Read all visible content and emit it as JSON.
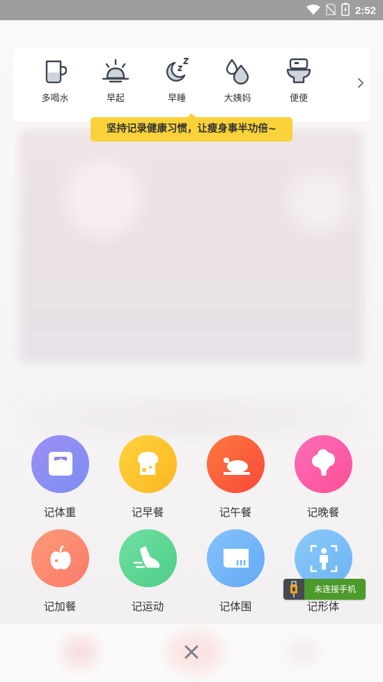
{
  "status_bar": {
    "time": "2:52"
  },
  "habits": [
    {
      "label": "多喝水",
      "icon": "cup-icon"
    },
    {
      "label": "早起",
      "icon": "sunrise-icon"
    },
    {
      "label": "早睡",
      "icon": "moon-sleep-icon"
    },
    {
      "label": "大姨妈",
      "icon": "drops-icon"
    },
    {
      "label": "便便",
      "icon": "toilet-icon"
    }
  ],
  "tooltip": "坚持记录健康习惯，让瘦身事半功倍~",
  "actions": [
    {
      "label": "记体重",
      "icon": "scale-icon",
      "color": "#8a86f0"
    },
    {
      "label": "记早餐",
      "icon": "bread-icon",
      "color": "#fdc22b"
    },
    {
      "label": "记午餐",
      "icon": "roast-chicken-icon",
      "color": "#fb5e3b"
    },
    {
      "label": "记晚餐",
      "icon": "broccoli-icon",
      "color": "#fb5da6"
    },
    {
      "label": "记加餐",
      "icon": "apple-icon",
      "color": "#fd8971"
    },
    {
      "label": "记运动",
      "icon": "shoe-icon",
      "color": "#5ed696"
    },
    {
      "label": "记体围",
      "icon": "tape-measure-icon",
      "color": "#74b6f8"
    },
    {
      "label": "记形体",
      "icon": "body-shape-icon",
      "color": "#7cc0f7"
    }
  ],
  "badge": {
    "text": "未连接手机"
  },
  "colors": {
    "tooltip_bg": "#f9d23a",
    "status_bar": "#9e9e9e",
    "badge_green": "#4c9a2a"
  }
}
